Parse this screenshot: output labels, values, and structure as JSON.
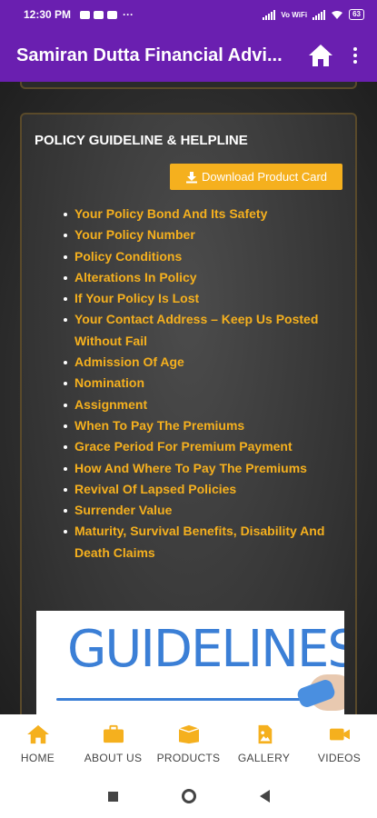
{
  "status_bar": {
    "time": "12:30 PM",
    "network_label": "Vo WiFi",
    "battery": "63"
  },
  "app_bar": {
    "title": "Samiran Dutta Financial Advi...",
    "home_icon": "home-icon",
    "more_icon": "more-vert-icon"
  },
  "card": {
    "title": "POLICY GUIDELINE & HELPLINE",
    "download_label": "Download Product Card",
    "items": [
      "Your Policy Bond And Its Safety",
      "Your Policy Number",
      "Policy Conditions",
      "Alterations In Policy",
      "If Your Policy Is Lost",
      "Your Contact Address – Keep Us Posted Without Fail",
      "Admission Of Age",
      "Nomination",
      "Assignment",
      "When To Pay The Premiums",
      "Grace Period For Premium Payment",
      "How And Where To Pay The Premiums",
      "Revival Of Lapsed Policies",
      "Surrender Value",
      "Maturity, Survival Benefits, Disability And Death Claims"
    ],
    "image_text": "GUIDELINES"
  },
  "bottom_nav": {
    "items": [
      {
        "label": "HOME",
        "icon": "home-icon"
      },
      {
        "label": "ABOUT US",
        "icon": "briefcase-icon"
      },
      {
        "label": "PRODUCTS",
        "icon": "box-icon"
      },
      {
        "label": "GALLERY",
        "icon": "image-file-icon"
      },
      {
        "label": "VIDEOS",
        "icon": "video-camera-icon"
      }
    ]
  },
  "colors": {
    "primary": "#6a1fb0",
    "accent": "#f5b01e"
  }
}
